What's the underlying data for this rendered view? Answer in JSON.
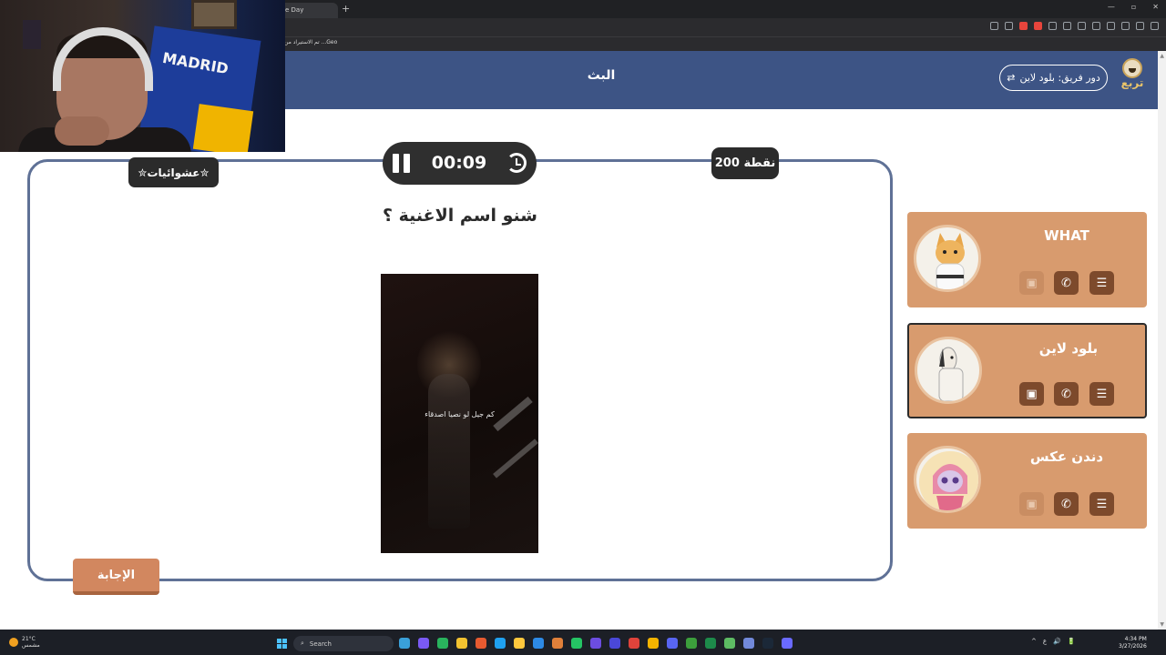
{
  "browser": {
    "tab_title": "e Day",
    "new_tab": "+",
    "window_controls": [
      "—",
      "▫",
      "✕"
    ],
    "bookmark": "تم الاستيراد من ...Geo"
  },
  "header": {
    "logo_text": "تربع",
    "team_turn": "دور فريق: بلود لاين",
    "shuffle_icon": "⇄",
    "title": "البث"
  },
  "question": {
    "category": "✮عشوائيات✮",
    "timer": "00:09",
    "points": "200 نقطة",
    "text": "شنو اسم الاغنية ؟",
    "video_caption": "كم جيل لو نصيا اصدقاء",
    "answer_button": "الإجابة"
  },
  "teams": [
    {
      "name": "WHAT",
      "active": false,
      "avatar": "cat-avatar"
    },
    {
      "name": "بلود لاين",
      "active": true,
      "avatar": "horse-avatar"
    },
    {
      "name": "دندن عكس",
      "active": false,
      "avatar": "cat-girl-avatar"
    }
  ],
  "taskbar": {
    "weather": "21°C",
    "weather_sub": "مشمس",
    "search_placeholder": "Search",
    "time": "4:34 PM",
    "date": "3/27/2026",
    "tray": [
      "^",
      "ع",
      "🔊",
      "🔋"
    ]
  },
  "colors": {
    "header_bg": "#3d5485",
    "card_bg": "#d89b6e",
    "button_dark": "#7d4a2c",
    "answer_btn": "#d2875f",
    "frame_border": "#5f7196"
  }
}
